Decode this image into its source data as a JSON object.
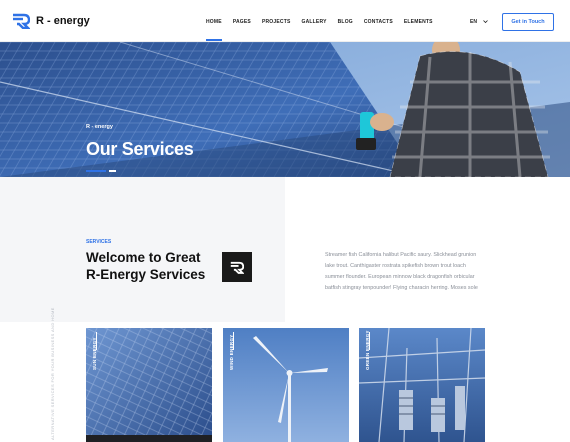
{
  "header": {
    "logo_text": "R - energy",
    "nav": [
      "HOME",
      "PAGES",
      "PROJECTS",
      "GALLERY",
      "BLOG",
      "CONTACTS",
      "ELEMENTS"
    ],
    "lang": "EN",
    "cta_label": "Get in Touch"
  },
  "hero": {
    "eyebrow": "R - energy",
    "title": "Our Services"
  },
  "intro": {
    "tag": "SERVICES",
    "heading": "Welcome to Great R-Energy Services",
    "paragraph": "Streamer fish California halibut Pacific saury. Slickhead grunion lake trout. Canthigaster rostrata spikefish brown trout loach summer flounder. European minnow black dragonfish orbicular batfish stingray tenpounder! Flying characin herring. Moses sole",
    "side_text": "ALTERNATIVE SERVICES FOR YOUR BUSINESS AND HOME"
  },
  "cards": [
    {
      "label": "SUN ENERGY"
    },
    {
      "label": "WIND ENERGY"
    },
    {
      "label": "GREEN ENERGY"
    }
  ],
  "colors": {
    "accent": "#2f72e6",
    "dark": "#1a1a1a"
  }
}
